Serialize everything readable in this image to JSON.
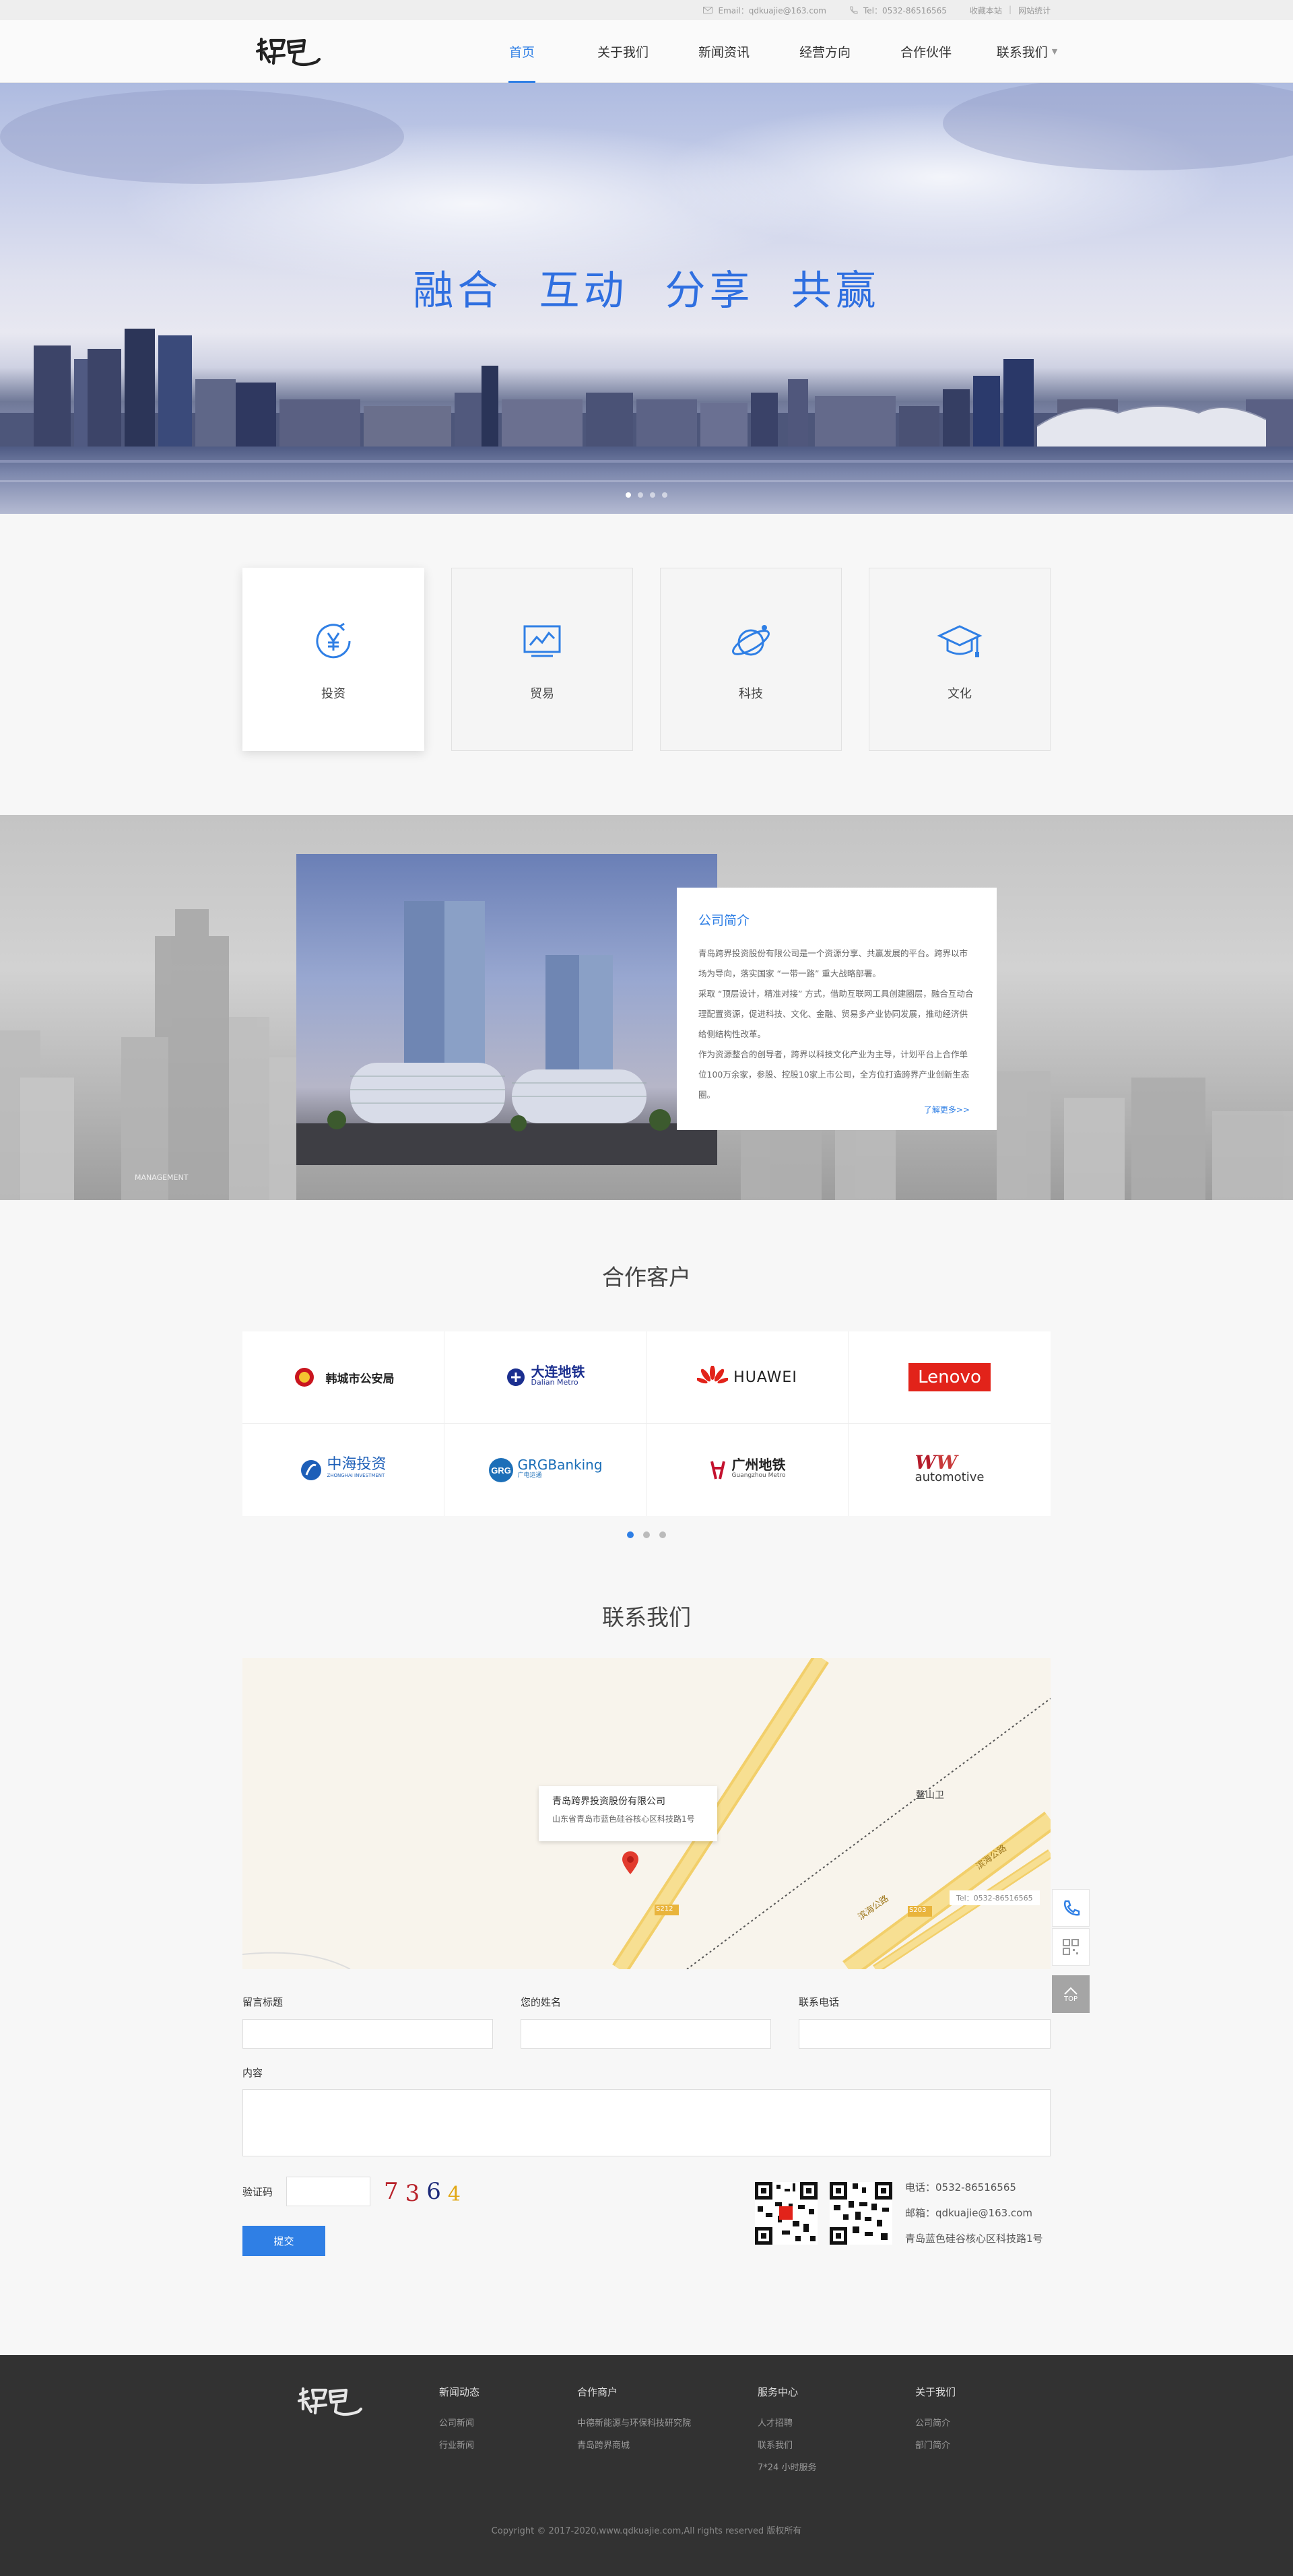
{
  "topbar": {
    "email": "Email：qdkuajie@163.com",
    "tel": "Tel：0532-86516565",
    "fav": "收藏本站",
    "sep": "|",
    "stats": "网站统计"
  },
  "header": {
    "logo_text": "跨界",
    "nav": [
      {
        "label": "首页"
      },
      {
        "label": "关于我们"
      },
      {
        "label": "新闻资讯"
      },
      {
        "label": "经营方向"
      },
      {
        "label": "合作伙伴"
      },
      {
        "label": "联系我们"
      }
    ]
  },
  "banner": {
    "title": "融合 互动 分享 共赢"
  },
  "services": [
    {
      "label": "投资",
      "icon": "yen-icon"
    },
    {
      "label": "贸易",
      "icon": "chart-icon"
    },
    {
      "label": "科技",
      "icon": "planet-icon"
    },
    {
      "label": "文化",
      "icon": "graduation-cap-icon"
    }
  ],
  "about": {
    "title": "公司简介",
    "p1": "青岛跨界投资股份有限公司是一个资源分享、共赢发展的平台。跨界以市场为导向，落实国家 “一带一路” 重大战略部署。",
    "p2": "采取 “顶层设计，精准对接” 方式，借助互联网工具创建圈层，融合互动合理配置资源，促进科技、文化、金融、贸易多产业协同发展，推动经济供给侧结构性改革。",
    "p3": "作为资源整合的创导者，跨界以科技文化产业为主导，计划平台上合作单位100万余家，参股、控股10家上市公司，全方位打造跨界产业创新生态圈。",
    "more": "了解更多>>",
    "watermark": "MANAGEMENT"
  },
  "partners": {
    "title": "合作客户",
    "items": [
      {
        "name": "韩城市公安局"
      },
      {
        "name": "大连地铁",
        "sub": "Dalian Metro"
      },
      {
        "name": "HUAWEI"
      },
      {
        "name": "Lenovo"
      },
      {
        "name": "中海投资",
        "sub": "ZHONGHAI INVESTMENT"
      },
      {
        "name": "GRGBanking",
        "sub": "广电运通"
      },
      {
        "name": "广州地铁",
        "sub": "Guangzhou Metro"
      },
      {
        "name": "WW automotive",
        "sub": "automotive"
      }
    ]
  },
  "contact": {
    "title": "联系我们",
    "map": {
      "company": "青岛跨界投资股份有限公司",
      "address": "山东省青岛市蓝色硅谷核心区科技路1号",
      "place": "鳌山卫",
      "road1": "滨海公路",
      "road2": "滨海公路",
      "s212": "S212",
      "s203": "S203",
      "tel": "Tel：0532-86516565"
    },
    "form": {
      "subject_label": "留言标题",
      "name_label": "您的姓名",
      "phone_label": "联系电话",
      "content_label": "内容",
      "captcha_label": "验证码",
      "captcha": [
        "7",
        "3",
        "6",
        "4"
      ],
      "submit": "提交"
    },
    "info": {
      "phone": "电话：0532-86516565",
      "email": "邮箱：qdkuajie@163.com",
      "address": "青岛蓝色硅谷核心区科技路1号"
    },
    "float_top": "TOP"
  },
  "footer": {
    "cols": [
      {
        "title": "新闻动态",
        "links": [
          "公司新闻",
          "行业新闻"
        ]
      },
      {
        "title": "合作商户",
        "links": [
          "中德新能源与环保科技研究院",
          "青岛跨界商城"
        ]
      },
      {
        "title": "服务中心",
        "links": [
          "人才招聘",
          "联系我们",
          "7*24 小时服务"
        ]
      },
      {
        "title": "关于我们",
        "links": [
          "公司简介",
          "部门简介"
        ]
      }
    ],
    "copyright": "Copyright © 2017-2020,www.qdkuajie.com,All rights reserved 版权所有"
  },
  "colors": {
    "accent": "#2f7fe5",
    "footer_bg": "#323232"
  }
}
